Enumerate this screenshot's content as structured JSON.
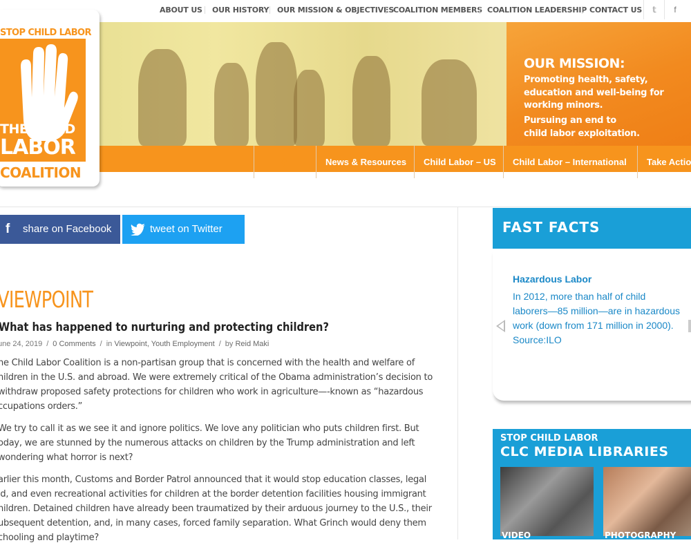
{
  "top_nav": {
    "items": [
      "ABOUT US",
      "OUR HISTORY",
      "OUR MISSION & OBJECTIVES",
      "COALITION MEMBERS",
      "COALITION LEADERSHIP",
      "CONTACT US"
    ],
    "social": [
      {
        "icon": "twitter-icon",
        "glyph": "𝕥"
      },
      {
        "icon": "facebook-icon",
        "glyph": "f"
      }
    ]
  },
  "logo": {
    "top": "STOP CHILD LABOR",
    "line1": "THE CHILD",
    "line2": "LABOR",
    "line3": "COALITION"
  },
  "mission": {
    "title": "OUR MISSION:",
    "lines": [
      "Promoting health, safety,",
      "education and well-being for",
      "working minors.",
      "Pursuing an end to",
      "child labor exploitation."
    ]
  },
  "main_menu": {
    "search_icon": "⚲",
    "items": [
      "News & Resources",
      "Child Labor – US",
      "Child Labor – International",
      "Take Actio"
    ]
  },
  "share": {
    "facebook": "share on Facebook",
    "twitter": "tweet on Twitter"
  },
  "post": {
    "category": "VIEWPOINT",
    "title": "What has happened to nurturing and protecting children?",
    "meta": {
      "date": "une 24, 2019",
      "comments": "0 Comments",
      "in_prefix": "in",
      "categories": "Viewpoint, Youth Employment",
      "by_prefix": "by",
      "author": "Reid Maki"
    },
    "paragraphs": [
      [
        "he Child Labor Coalition is a non-partisan group that is concerned with the health and welfare of",
        "hildren in the U.S. and abroad. We were extremely critical of the Obama administration’s decision to",
        "withdraw proposed safety protections for children who work in agriculture—-known as “hazardous",
        "ccupations orders.”"
      ],
      [
        "We try to call it as we see it and ignore politics. We love any politician who puts children first. But",
        "oday, we are stunned by the numerous attacks on children by the Trump administration and left",
        "wondering what horror is next?"
      ],
      [
        "arlier this month, Customs and Border Patrol announced that it would stop education classes, legal",
        "id, and even recreational activities for children at the border detention facilities housing immigrant",
        "hildren. Detained children have already been traumatized by their arduous journey to the U.S., their",
        "ubsequent detention, and, in many cases, forced family separation. What Grinch would deny them",
        "chooling and playtime?"
      ]
    ]
  },
  "fast_facts": {
    "header": "FAST FACTS",
    "title": "Hazardous Labor",
    "text_lines": [
      "In 2012, more than half of child",
      "laborers—85 million—are in hazardous",
      "work (down from 171 million in 2000).",
      "Source:ILO"
    ]
  },
  "media_libraries": {
    "line1": "STOP CHILD LABOR",
    "line2": "CLC MEDIA LIBRARIES",
    "video": "VIDEO",
    "photography": "PHOTOGRAPHY"
  },
  "colors": {
    "orange": "#f7941d",
    "blue": "#1a9fd7",
    "facebook": "#3b5998",
    "twitter": "#1da1f2"
  }
}
